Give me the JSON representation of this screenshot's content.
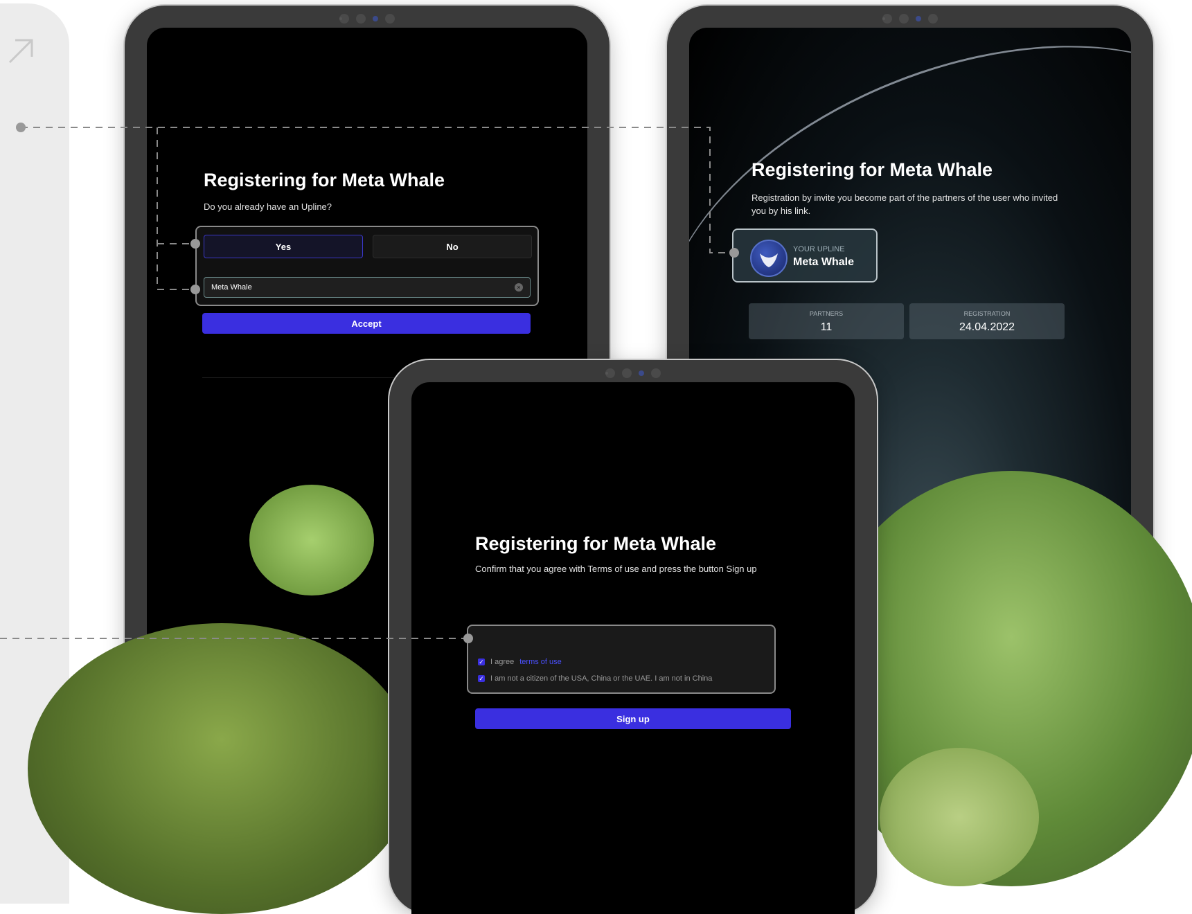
{
  "tablet_a": {
    "title": "Registering for Meta Whale",
    "question": "Do you already have an Upline?",
    "yes_label": "Yes",
    "no_label": "No",
    "upline_input_value": "Meta Whale",
    "accept_label": "Accept"
  },
  "tablet_b": {
    "title": "Registering for Meta Whale",
    "description": "Registration by invite you become part of the partners of the user who invited you by his link.",
    "upline_label": "YOUR UPLINE",
    "upline_name": "Meta Whale",
    "partners_label": "PARTNERS",
    "partners_value": "11",
    "registration_label": "REGISTRATION",
    "registration_value": "24.04.2022"
  },
  "tablet_c": {
    "title": "Registering for Meta Whale",
    "description": "Confirm that you agree with Terms of use and press the button Sign up",
    "agree_prefix": "I agree",
    "terms_link": "terms of use",
    "citizenship_text": "I am not a citizen of the USA, China or the UAE. I am not in China",
    "signup_label": "Sign up"
  },
  "colors": {
    "accent": "#3a2fe0",
    "background": "#ffffff",
    "panel": "#ececec"
  }
}
